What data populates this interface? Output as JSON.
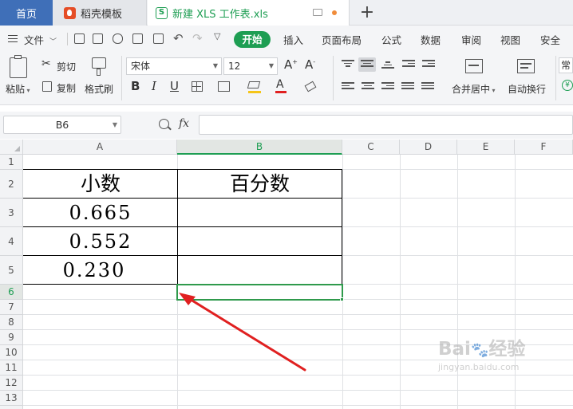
{
  "tabs": {
    "home": "首页",
    "template": "稻壳模板",
    "document": "新建 XLS 工作表.xls"
  },
  "menu": {
    "file": "文件",
    "start": "开始",
    "items": [
      "插入",
      "页面布局",
      "公式",
      "数据",
      "审阅",
      "视图",
      "安全"
    ]
  },
  "ribbon": {
    "paste": "粘贴",
    "cut": "剪切",
    "copy": "复制",
    "format_painter": "格式刷",
    "font_name": "宋体",
    "font_size": "12",
    "merge_center": "合并居中",
    "wrap_text": "自动换行",
    "more": "常"
  },
  "formula_bar": {
    "name_box": "B6",
    "fx": "fx",
    "formula": ""
  },
  "sheet": {
    "columns": [
      "A",
      "B",
      "C",
      "D",
      "E",
      "F"
    ],
    "rows": [
      "1",
      "2",
      "3",
      "4",
      "5",
      "6",
      "7",
      "8",
      "9",
      "10",
      "11",
      "12",
      "13"
    ],
    "header_a2": "小数",
    "header_b2": "百分数",
    "a3": "0.665",
    "a4": "0.552",
    "a5": "0.230",
    "selected_cell": "B6"
  },
  "colors": {
    "accent": "#1e9e53",
    "home_tab": "#3f6fb8",
    "arrow": "#e02020"
  },
  "watermark": {
    "brand": "Bai",
    "brand2": "经验",
    "url": "jingyan.baidu.com"
  }
}
